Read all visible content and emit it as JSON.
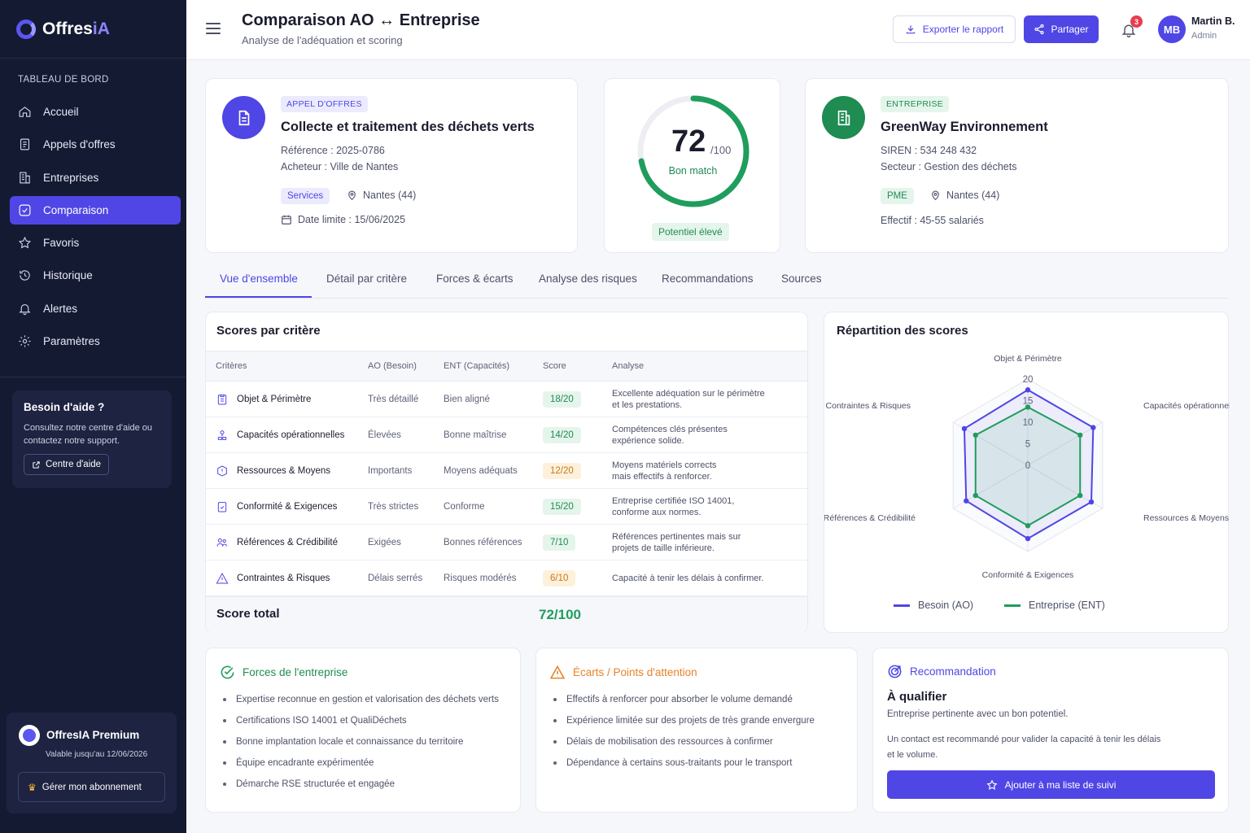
{
  "app": {
    "logo_main": "Offres",
    "logo_accent": "iA"
  },
  "sidebar": {
    "section_label": "TABLEAU DE BORD",
    "items": [
      {
        "label": "Accueil",
        "icon": "home-icon"
      },
      {
        "label": "Appels d'offres",
        "icon": "document-icon"
      },
      {
        "label": "Entreprises",
        "icon": "building-icon"
      },
      {
        "label": "Comparaison",
        "icon": "compare-icon",
        "active": true
      },
      {
        "label": "Favoris",
        "icon": "star-icon"
      },
      {
        "label": "Historique",
        "icon": "history-icon"
      },
      {
        "label": "Alertes",
        "icon": "bell-icon"
      },
      {
        "label": "Paramètres",
        "icon": "gear-icon"
      }
    ],
    "help": {
      "title": "Besoin d'aide ?",
      "text": "Consultez notre centre d'aide ou contactez notre support.",
      "button": "Centre d'aide"
    },
    "premium": {
      "title": "OffresIA Premium",
      "valid": "Valable jusqu'au 12/06/2026",
      "button": "Gérer mon abonnement"
    }
  },
  "header": {
    "title": "Comparaison AO ↔ Entreprise",
    "subtitle": "Analyse de l'adéquation et scoring",
    "export_label": "Exporter le rapport",
    "share_label": "Partager",
    "notifications": "3",
    "user": {
      "initials": "MB",
      "name": "Martin B.",
      "role": "Admin"
    }
  },
  "tender": {
    "tag": "APPEL D'OFFRES",
    "title": "Collecte et traitement des déchets verts",
    "reference": "Référence : 2025-0786",
    "buyer": "Acheteur :  Ville de Nantes",
    "category": "Services",
    "location": "Nantes (44)",
    "deadline": "Date limite : 15/06/2025"
  },
  "score_card": {
    "score": "72",
    "max": "/100",
    "score_fraction": 0.72,
    "label": "Bon match",
    "badge": "Potentiel élevé"
  },
  "company": {
    "tag": "ENTREPRISE",
    "title": "GreenWay Environnement",
    "siren": "SIREN : 534 248 432",
    "sector": "Secteur : Gestion des déchets",
    "size_chip": "PME",
    "location": "Nantes (44)",
    "staff": "Effectif :  45-55 salariés"
  },
  "tabs": [
    "Vue d'ensemble",
    "Détail par critère",
    "Forces & écarts",
    "Analyse des risques",
    "Recommandations",
    "Sources"
  ],
  "scores_table": {
    "title": "Scores par critère",
    "headers": [
      "Critères",
      "AO (Besoin)",
      "ENT (Capacités)",
      "Score",
      "Analyse"
    ],
    "rows": [
      {
        "criterion": "Objet & Périmètre",
        "icon": "clipboard-icon",
        "ao": "Très détaillé",
        "ent": "Bien aligné",
        "score": "18/20",
        "tone": "g",
        "analysis_1": "Excellente adéquation sur le périmètre",
        "analysis_2": "et les prestations."
      },
      {
        "criterion": "Capacités opérationnelles",
        "icon": "team-icon",
        "ao": "Élevées",
        "ent": "Bonne maîtrise",
        "score": "14/20",
        "tone": "g",
        "analysis_1": "Compétences clés présentes",
        "analysis_2": "expérience solide."
      },
      {
        "criterion": "Ressources & Moyens",
        "icon": "resources-icon",
        "ao": "Importants",
        "ent": "Moyens adéquats",
        "score": "12/20",
        "tone": "o",
        "analysis_1": "Moyens matériels corrects",
        "analysis_2": "mais effectifs à renforcer."
      },
      {
        "criterion": "Conformité & Exigences",
        "icon": "checklist-icon",
        "ao": "Très strictes",
        "ent": "Conforme",
        "score": "15/20",
        "tone": "g",
        "analysis_1": "Entreprise certifiée ISO 14001,",
        "analysis_2": "conforme aux normes."
      },
      {
        "criterion": "Références & Crédibilité",
        "icon": "references-icon",
        "ao": "Exigées",
        "ent": "Bonnes références",
        "score": "7/10",
        "tone": "g",
        "analysis_1": "Références pertinentes mais sur",
        "analysis_2": "projets de taille inférieure."
      },
      {
        "criterion": "Contraintes & Risques",
        "icon": "warning-icon",
        "ao": "Délais serrés",
        "ent": "Risques modérés",
        "score": "6/10",
        "tone": "o",
        "analysis_1": "Capacité à tenir les délais à confirmer.",
        "analysis_2": ""
      }
    ],
    "total_label": "Score total",
    "total_value": "72/100"
  },
  "chart_data": {
    "type": "radar",
    "title": "Répartition des scores",
    "categories": [
      "Objet & Périmètre",
      "Capacités opérationnelles",
      "Ressources & Moyens",
      "Conformité & Exigences",
      "Références & Crédibilité",
      "Contraintes & Risques"
    ],
    "rlim": [
      0,
      20
    ],
    "ticks": [
      "0",
      "5",
      "10",
      "15",
      "20"
    ],
    "series": [
      {
        "name": "Besoin (AO)",
        "color": "#4f46e5",
        "values": [
          17.5,
          17.5,
          17,
          17,
          16.5,
          17
        ]
      },
      {
        "name": "Entreprise (ENT)",
        "color": "#1f9d5c",
        "values": [
          13.5,
          14,
          14,
          14,
          14,
          14
        ]
      }
    ],
    "legend": "bottom"
  },
  "strengths": {
    "title": "Forces de l'entreprise",
    "items": [
      "Expertise reconnue en gestion et valorisation des déchets verts",
      "Certifications ISO 14001 et QualiDéchets",
      "Bonne implantation locale et connaissance du territoire",
      "Équipe encadrante expérimentée",
      "Démarche RSE structurée et engagée"
    ]
  },
  "gaps": {
    "title": "Écarts / Points d'attention",
    "items": [
      "Effectifs à renforcer pour absorber le volume demandé",
      "Expérience limitée sur des projets de très grande envergure",
      "Délais de mobilisation des ressources à confirmer",
      "Dépendance à certains sous-traitants pour le transport"
    ]
  },
  "recommendation": {
    "title": "Recommandation",
    "verdict": "À qualifier",
    "summary": "Entreprise pertinente avec un bon potentiel.",
    "detail_1": "Un contact est recommandé pour valider la capacité à tenir les délais",
    "detail_2": "et le volume.",
    "button": "Ajouter à ma liste de suivi"
  },
  "colors": {
    "accent": "#4f46e5",
    "success": "#1f9d5c",
    "warning": "#e8822a",
    "sidebar": "#151a33"
  }
}
